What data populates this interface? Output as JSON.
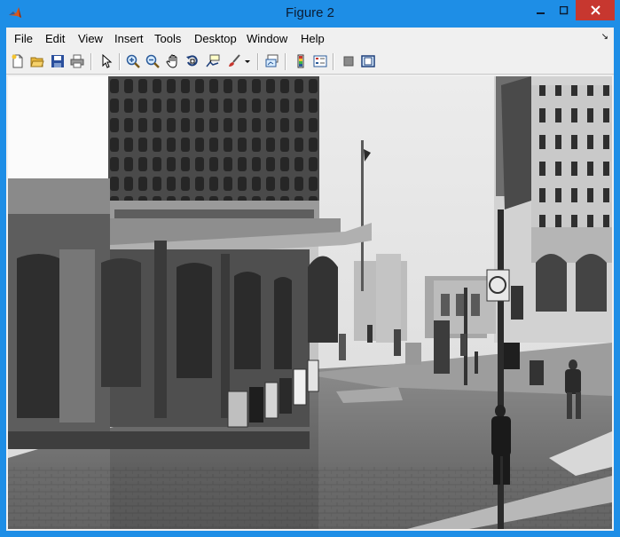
{
  "window": {
    "title": "Figure 2"
  },
  "menu": {
    "items": [
      "File",
      "Edit",
      "View",
      "Insert",
      "Tools",
      "Desktop",
      "Window",
      "Help"
    ]
  },
  "toolbar": {
    "buttons": [
      "new-figure",
      "open-file",
      "save-figure",
      "print-figure",
      "edit-plot",
      "zoom-in",
      "zoom-out",
      "pan",
      "rotate-3d",
      "data-cursor",
      "brush",
      "brush-menu",
      "link-plot",
      "insert-colorbar",
      "insert-legend",
      "hide-plot-tools",
      "show-plot-tools"
    ]
  },
  "image": {
    "description_icons": "grayscale street scene",
    "colors": {
      "accent": "#1e8ee6",
      "close": "#c7372f"
    }
  }
}
